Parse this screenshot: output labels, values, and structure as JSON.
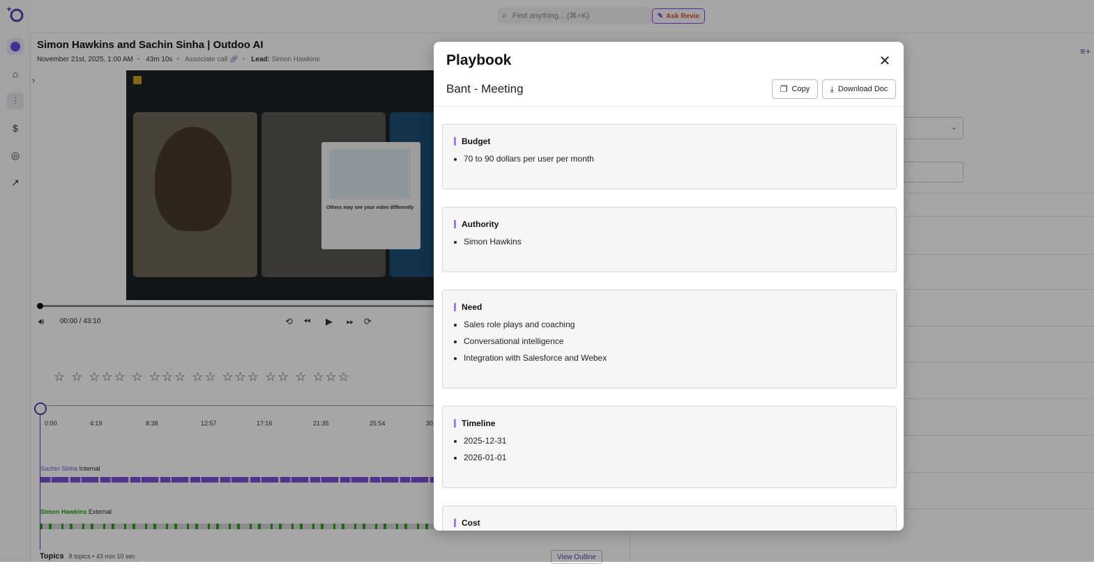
{
  "app": {
    "search_placeholder": "Find anything... (⌘+K)",
    "ask_label": "Ask Revie"
  },
  "call": {
    "title": "Simon Hawkins and Sachin Sinha | Outdoo AI",
    "date": "November 21st, 2025, 1:00 AM",
    "duration": "43m 10s",
    "associate_label": "Associate call",
    "lead_label": "Lead:",
    "lead_name": "Simon Hawkins"
  },
  "video": {
    "popup_title": "Others may see your video differently",
    "time": "00:00 / 43:10"
  },
  "timeline": {
    "labels": [
      "0:00",
      "4:19",
      "8:38",
      "12:57",
      "17:16",
      "21:35",
      "25:54",
      "30"
    ]
  },
  "speakers": [
    {
      "name": "Sachin Sinha",
      "role": "Internal",
      "color": "#7a4fd6"
    },
    {
      "name": "Simon Hawkins",
      "role": "External",
      "color": "#2f9e1f"
    }
  ],
  "topics": {
    "label": "Topics",
    "summary": "8 topics • 43 min 10 sec",
    "view_outline": "View Outline"
  },
  "modal": {
    "title": "Playbook",
    "subtitle": "Bant - Meeting",
    "copy_label": "Copy",
    "download_label": "Download Doc",
    "sections": [
      {
        "heading": "Budget",
        "items": [
          "70 to 90 dollars per user per month"
        ]
      },
      {
        "heading": "Authority",
        "items": [
          "Simon Hawkins"
        ]
      },
      {
        "heading": "Need",
        "items": [
          "Sales role plays and coaching",
          "Conversational intelligence",
          "Integration with Salesforce and Webex"
        ]
      },
      {
        "heading": "Timeline",
        "items": [
          "2025-12-31",
          "2026-01-01"
        ]
      },
      {
        "heading": "Cost",
        "items": []
      }
    ]
  },
  "colors": {
    "accent": "#a277f0",
    "brand": "#5a3db0"
  }
}
